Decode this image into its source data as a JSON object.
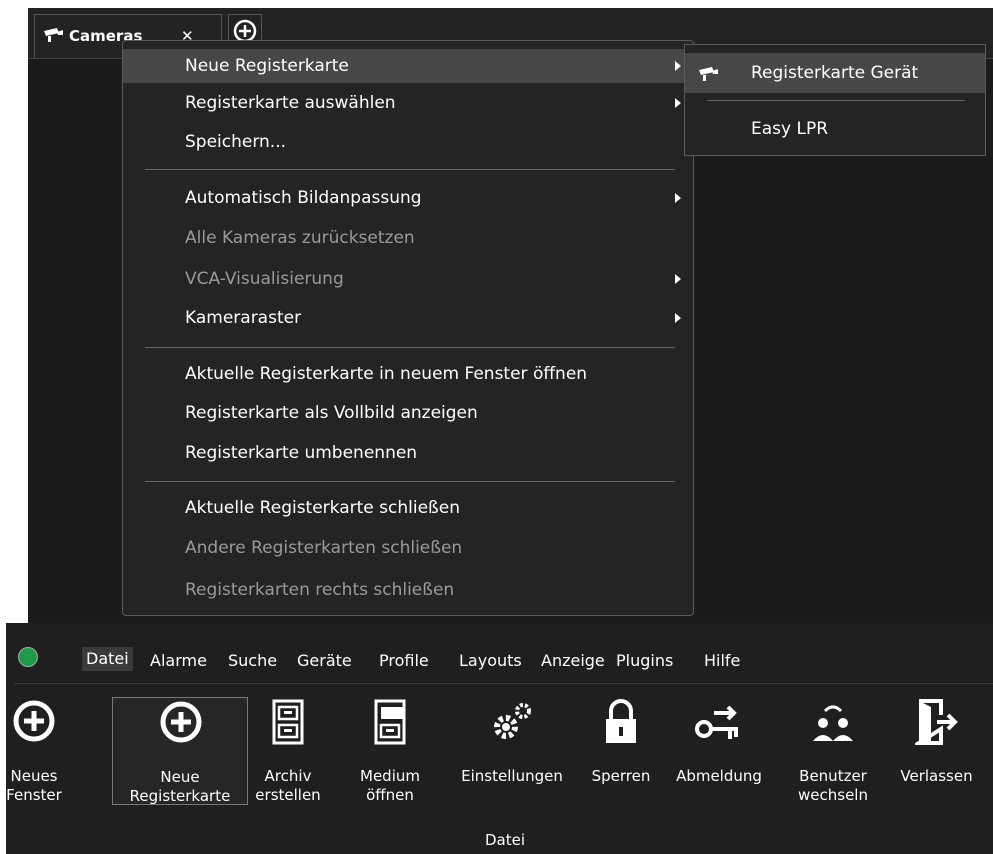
{
  "tab": {
    "label": "Cameras",
    "close": "✕"
  },
  "context_menu": [
    {
      "label": "Neue Registerkarte",
      "submenu": true,
      "disabled": false,
      "highlighted": true
    },
    {
      "label": "Registerkarte auswählen",
      "submenu": true,
      "disabled": false
    },
    {
      "label": "Speichern...",
      "submenu": false,
      "disabled": false
    },
    {
      "label": "Automatisch Bildanpassung",
      "submenu": true,
      "disabled": false
    },
    {
      "label": "Alle Kameras zurücksetzen",
      "submenu": false,
      "disabled": true
    },
    {
      "label": "VCA-Visualisierung",
      "submenu": true,
      "disabled": true
    },
    {
      "label": "Kameraraster",
      "submenu": true,
      "disabled": false
    },
    {
      "label": "Aktuelle Registerkarte in neuem Fenster öffnen",
      "submenu": false,
      "disabled": false
    },
    {
      "label": "Registerkarte als Vollbild anzeigen",
      "submenu": false,
      "disabled": false
    },
    {
      "label": "Registerkarte umbenennen",
      "submenu": false,
      "disabled": false
    },
    {
      "label": "Aktuelle Registerkarte schließen",
      "submenu": false,
      "disabled": false
    },
    {
      "label": "Andere Registerkarten schließen",
      "submenu": false,
      "disabled": true
    },
    {
      "label": "Registerkarten rechts schließen",
      "submenu": false,
      "disabled": true
    }
  ],
  "submenu": [
    {
      "label": "Registerkarte Gerät",
      "icon": "camera-icon",
      "highlighted": true
    },
    {
      "label": "Easy LPR"
    }
  ],
  "menubar": [
    "Datei",
    "Alarme",
    "Suche",
    "Geräte",
    "Profile",
    "Layouts",
    "Anzeige",
    "Plugins",
    "Hilfe"
  ],
  "toolbar": {
    "group_label": "Datei",
    "tools": [
      {
        "label": "Neues\nFenster",
        "icon": "add-circle-icon"
      },
      {
        "label": "Neue\nRegisterkarte",
        "icon": "add-circle-icon",
        "selected": true
      },
      {
        "label": "Archiv\nerstellen",
        "icon": "file-cabinet-icon"
      },
      {
        "label": "Medium\nöffnen",
        "icon": "file-cabinet-open-icon"
      },
      {
        "label": "Einstellungen",
        "icon": "gears-icon"
      },
      {
        "label": "Sperren",
        "icon": "lock-icon"
      },
      {
        "label": "Abmeldung",
        "icon": "key-logout-icon"
      },
      {
        "label": "Benutzer\nwechseln",
        "icon": "switch-user-icon"
      },
      {
        "label": "Verlassen",
        "icon": "exit-door-icon"
      }
    ]
  },
  "colors": {
    "background": "#1b1b1b",
    "menu": "#242424",
    "highlight": "#474747",
    "text": "#ffffff",
    "disabled": "#9a9a9a"
  }
}
